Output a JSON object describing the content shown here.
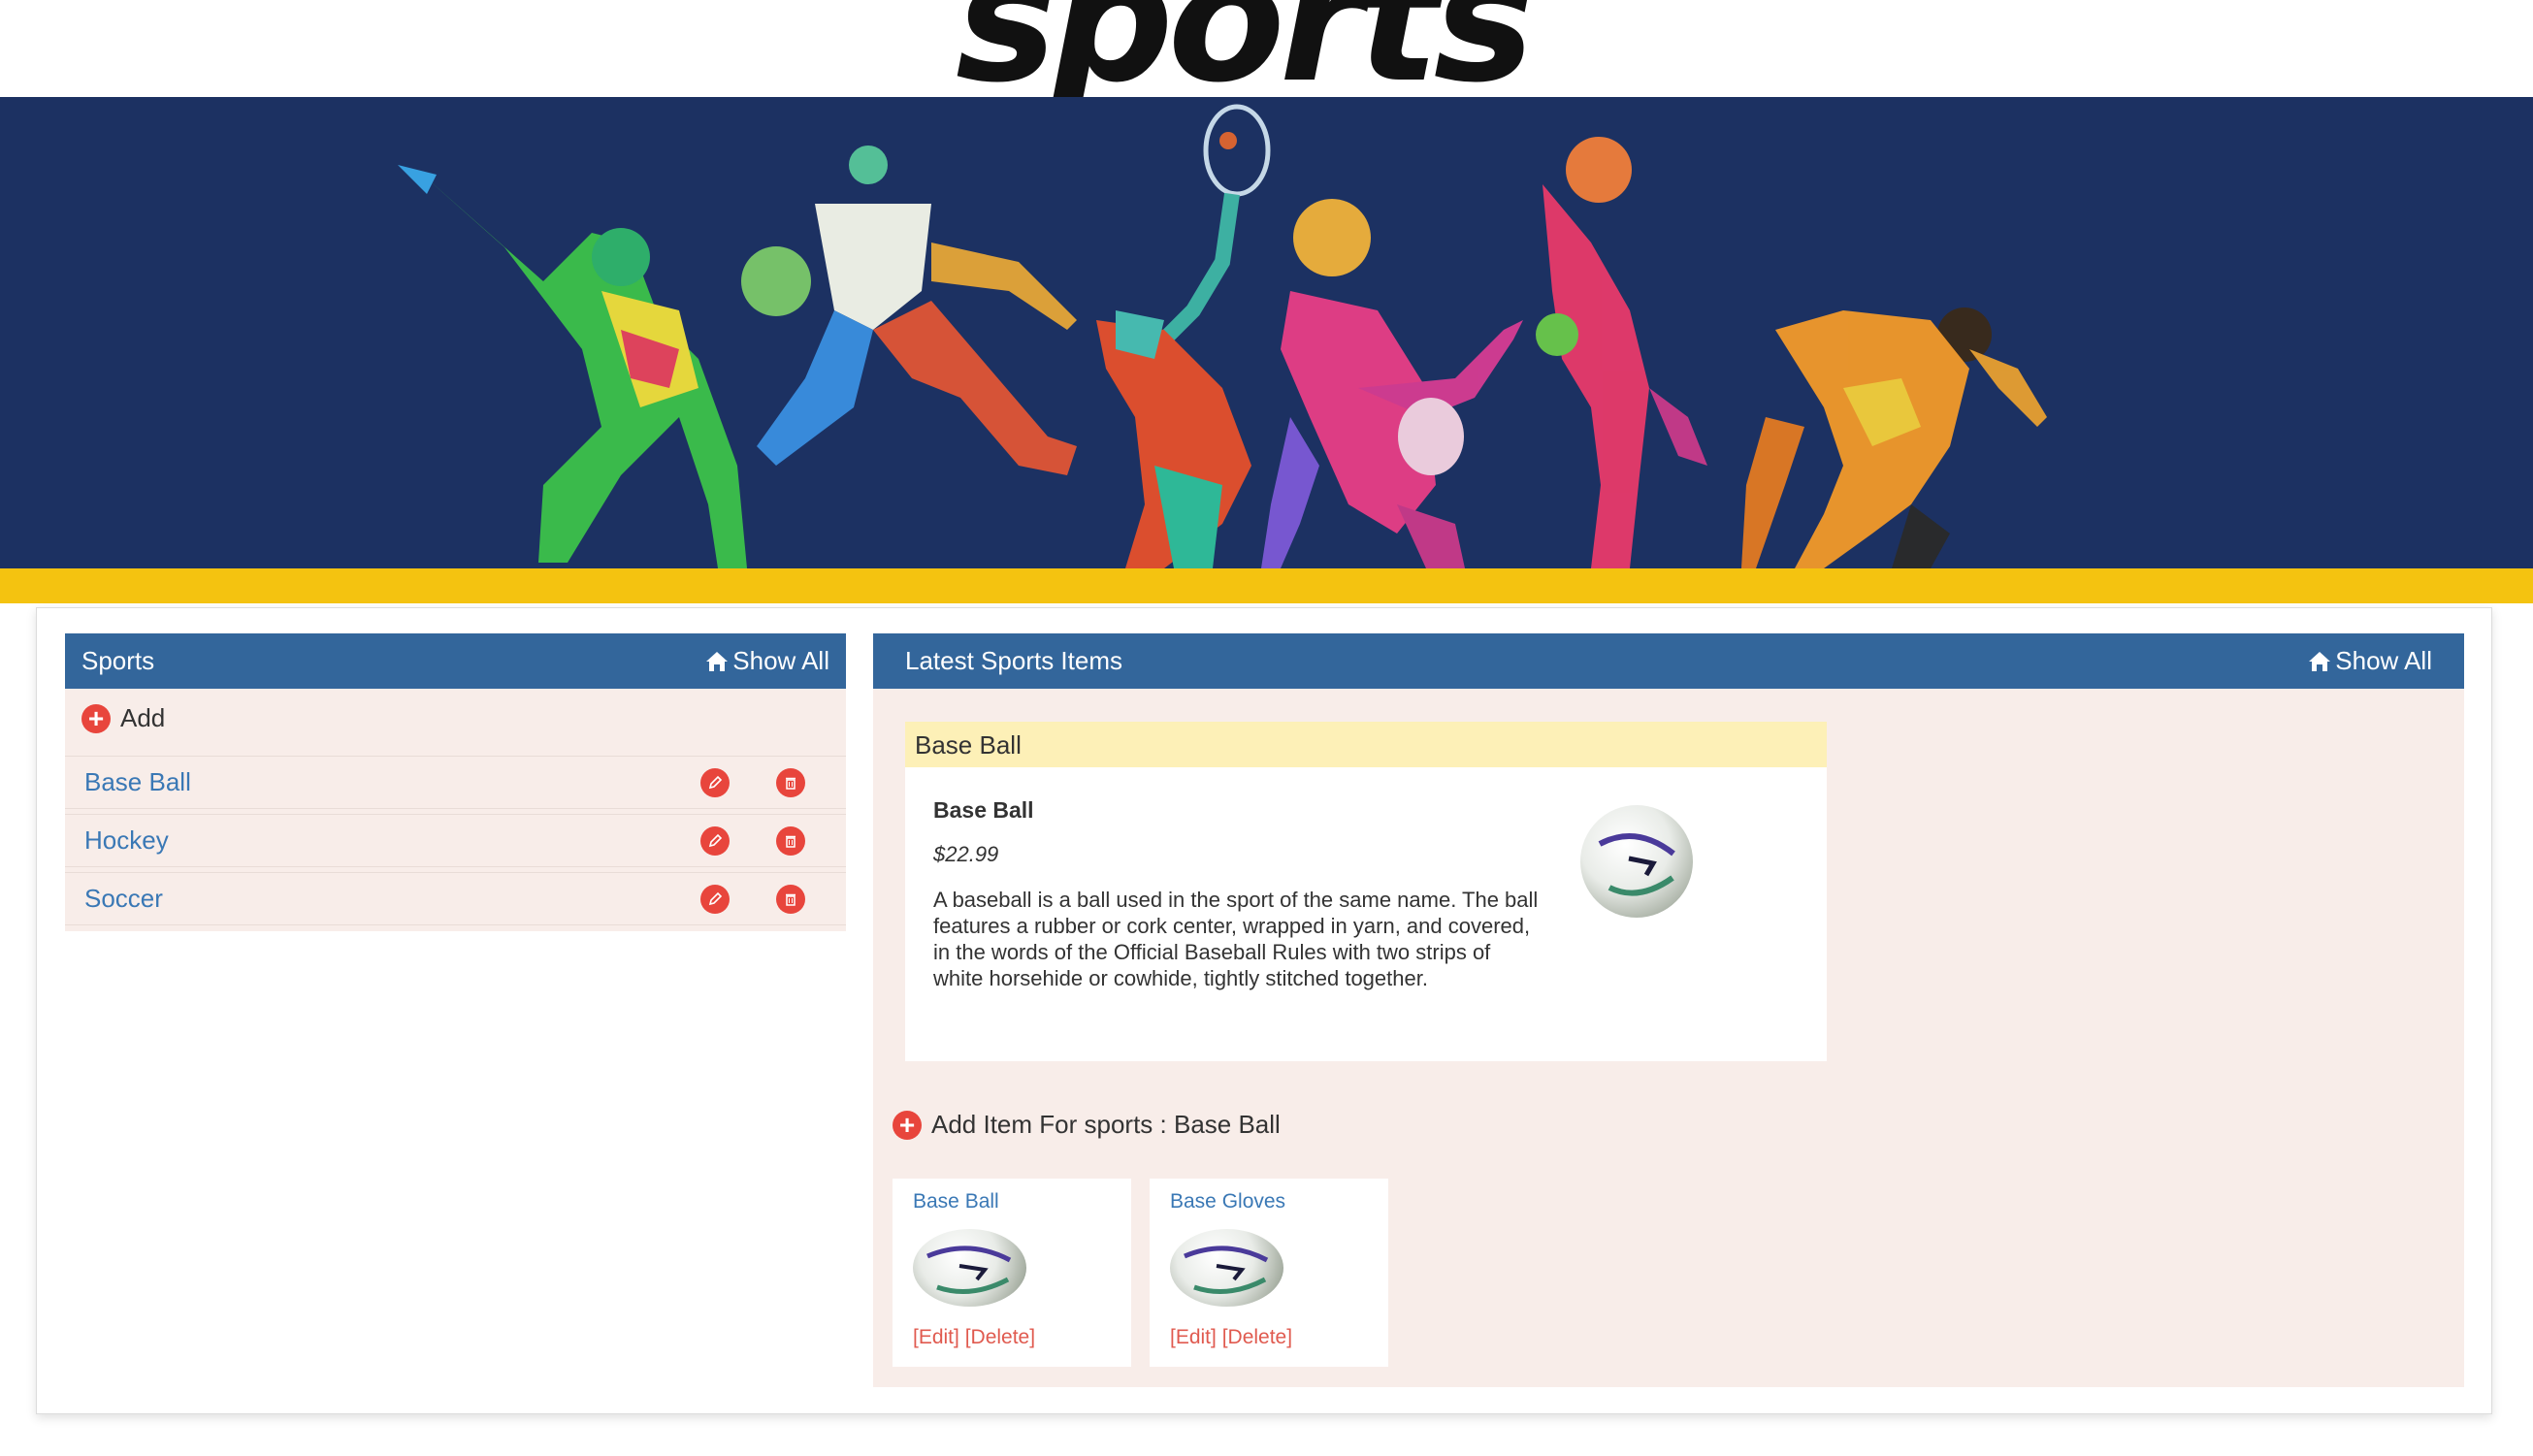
{
  "header": {
    "logo_text": "sports"
  },
  "sidebar": {
    "title": "Sports",
    "show_all": "Show All",
    "add_label": "Add",
    "items": [
      {
        "label": "Base Ball"
      },
      {
        "label": "Hockey"
      },
      {
        "label": "Soccer"
      }
    ]
  },
  "main": {
    "title": "Latest Sports Items",
    "show_all": "Show All",
    "featured": {
      "header": "Base Ball",
      "name": "Base Ball",
      "price": "$22.99",
      "description": "A baseball is a ball used in the sport of the same name. The ball features a rubber or cork center, wrapped in yarn, and covered, in the words of the Official Baseball Rules with two strips of white horsehide or cowhide, tightly stitched together."
    },
    "add_item_label": "Add Item For sports : Base Ball",
    "items": [
      {
        "name": "Base Ball",
        "edit": "[Edit]",
        "delete": "[Delete]"
      },
      {
        "name": "Base Gloves",
        "edit": "[Edit]",
        "delete": "[Delete]"
      }
    ]
  },
  "colors": {
    "banner_bg": "#1c3162",
    "accent_bar": "#f4c310",
    "panel_header": "#33669b",
    "panel_bg": "#f8ede9",
    "card_header": "#fdf0b7",
    "action_red": "#e8453c",
    "link_blue": "#3a78b5"
  },
  "icons": [
    "home-icon",
    "plus-circle-icon",
    "pencil-icon",
    "trash-icon",
    "soccer-ball-image"
  ]
}
